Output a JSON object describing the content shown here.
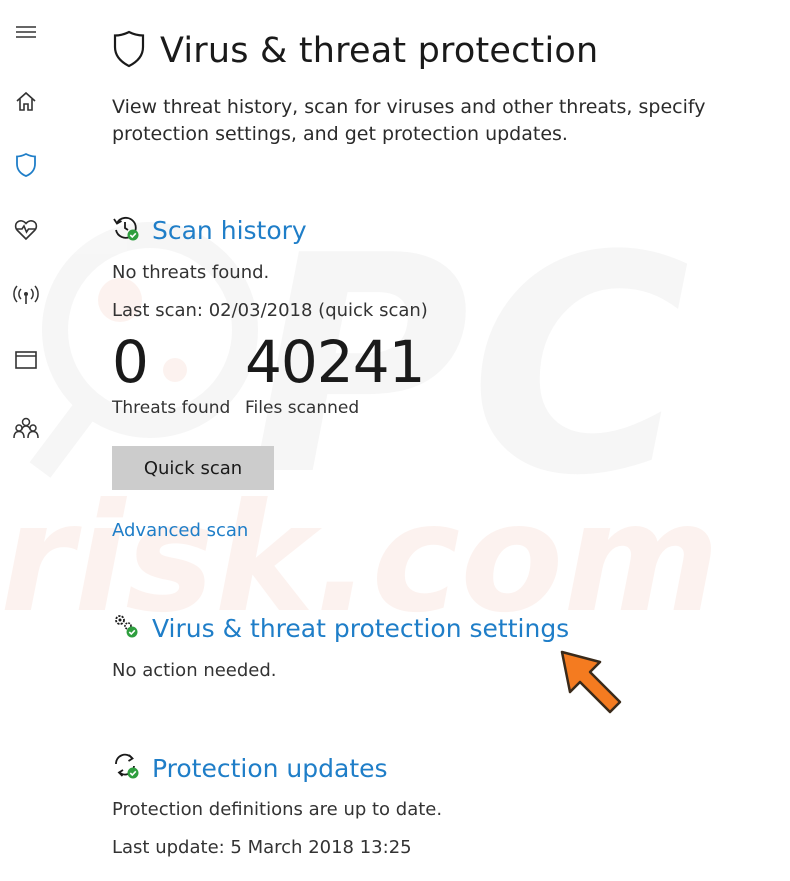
{
  "window": {
    "title": "Virus & threat protection"
  },
  "watermark": {
    "text_top": "PC",
    "text_bottom": "risk.com"
  },
  "nav": {
    "items": [
      {
        "icon": "hamburger-menu-icon"
      },
      {
        "icon": "home-icon"
      },
      {
        "icon": "shield-icon",
        "active": true
      },
      {
        "icon": "heart-pulse-icon"
      },
      {
        "icon": "wifi-antenna-icon"
      },
      {
        "icon": "app-browser-icon"
      },
      {
        "icon": "family-icon"
      }
    ],
    "active_color": "#1f7ec8"
  },
  "header": {
    "title": "Virus & threat protection",
    "description": "View threat history, scan for viruses and other threats, specify protection settings, and get protection updates."
  },
  "scan_history": {
    "title": "Scan history",
    "status": "No threats found.",
    "last_scan": "Last scan: 02/03/2018 (quick scan)",
    "threats_found_value": "0",
    "threats_found_label": "Threats found",
    "files_scanned_value": "40241",
    "files_scanned_label": "Files scanned",
    "quick_scan_label": "Quick scan",
    "advanced_scan_label": "Advanced scan"
  },
  "settings": {
    "title": "Virus & threat protection settings",
    "status": "No action needed."
  },
  "updates": {
    "title": "Protection updates",
    "status": "Protection definitions are up to date.",
    "last_update": "Last update: 5 March 2018 13:25"
  },
  "colors": {
    "accent": "#1f7ec8",
    "ok_green": "#2e9e3e",
    "button_bg": "#cccccc",
    "arrow": "#f47b20"
  }
}
